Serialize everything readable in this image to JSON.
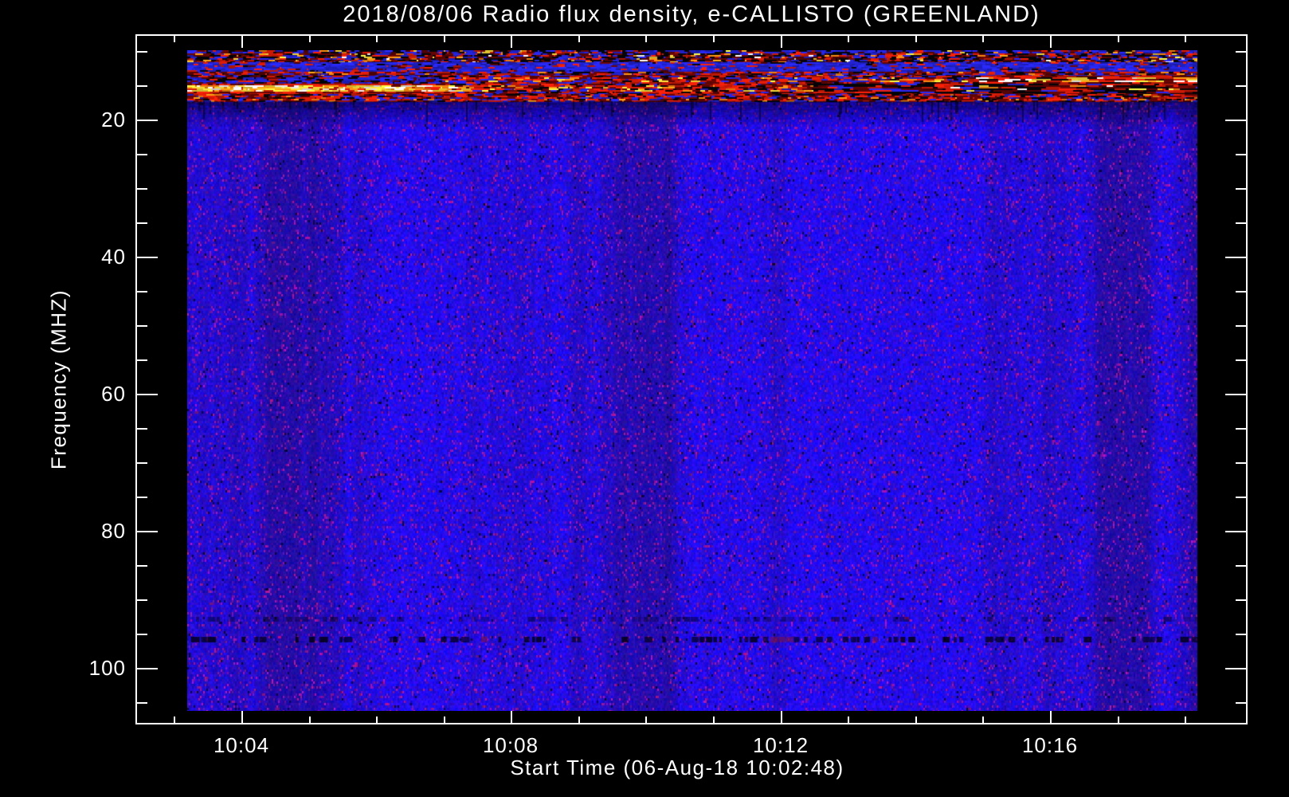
{
  "page": {
    "background": "#000000",
    "text_color": "#ffffff"
  },
  "chart_data": {
    "type": "heatmap",
    "title": "2018/08/06  Radio flux density, e-CALLISTO (GREENLAND)",
    "xlabel": "Start Time (06-Aug-18 10:02:48)",
    "ylabel": "Frequency (MHZ)",
    "x_ticks": [
      {
        "label": "10:04",
        "minute": 4
      },
      {
        "label": "10:08",
        "minute": 8
      },
      {
        "label": "10:12",
        "minute": 12
      },
      {
        "label": "10:16",
        "minute": 16
      }
    ],
    "x_minor_minutes": [
      3,
      5,
      6,
      7,
      9,
      10,
      11,
      13,
      14,
      15,
      17,
      18
    ],
    "y_ticks": [
      {
        "label": "20",
        "mhz": 20
      },
      {
        "label": "40",
        "mhz": 40
      },
      {
        "label": "60",
        "mhz": 60
      },
      {
        "label": "80",
        "mhz": 80
      },
      {
        "label": "100",
        "mhz": 100
      }
    ],
    "y_minor_mhz": [
      10,
      15,
      25,
      30,
      35,
      45,
      50,
      55,
      65,
      70,
      75,
      85,
      90,
      95,
      105
    ],
    "y_axis_inverted": true,
    "grid": false,
    "legend": false,
    "freq_range_mhz": [
      9.9,
      106.3
    ],
    "time_range": [
      "10:03:12",
      "10:18:11"
    ],
    "palette": {
      "blue": "#2323d8",
      "purple_speck": "#7a1aa0",
      "black": "#050508",
      "dark_red": "#5e0505",
      "red": "#d81c08",
      "orange": "#ff8c12",
      "yellow": "#ffe23a",
      "white": "#ffffff"
    },
    "background_noise": {
      "description": "blue vertical-striped noise with sparse purple-red specks",
      "speck_probability": 0.09,
      "dark_dot_probability": 0.015
    },
    "bands": [
      {
        "name": "edge-speckle",
        "freq_mhz": [
          9.9,
          10.35
        ],
        "kind": "speckle",
        "weights": {
          "blue": 0.4,
          "black": 0.22,
          "dark_red": 0.16,
          "red": 0.16,
          "orange": 0.04,
          "yellow": 0.02
        }
      },
      {
        "name": "rfi-heavy",
        "freq_mhz": [
          10.35,
          11.65
        ],
        "kind": "speckle",
        "weights": {
          "black": 0.3,
          "dark_red": 0.22,
          "red": 0.17,
          "blue": 0.2,
          "orange": 0.06,
          "yellow": 0.035,
          "white": 0.015
        }
      },
      {
        "name": "blue-red-speckle",
        "freq_mhz": [
          11.65,
          13.0
        ],
        "kind": "speckle",
        "weights": {
          "blue": 0.8,
          "red": 0.1,
          "dark_red": 0.06,
          "black": 0.04
        }
      },
      {
        "name": "red-mottle",
        "freq_mhz": [
          13.0,
          13.6
        ],
        "kind": "speckle",
        "weights": {
          "dark_red": 0.3,
          "red": 0.25,
          "blue": 0.28,
          "black": 0.13,
          "orange": 0.04
        }
      },
      {
        "name": "rfi-line-14",
        "freq_mhz": [
          13.6,
          14.8
        ],
        "kind": "segmented-line",
        "zones": [
          {
            "until_frac": 0.25,
            "weights": {
              "blue": 0.45,
              "black": 0.25,
              "dark_red": 0.18,
              "red": 0.12
            }
          },
          {
            "until_frac": 0.78,
            "weights": {
              "red": 0.3,
              "dark_red": 0.25,
              "blue": 0.25,
              "black": 0.1,
              "orange": 0.06,
              "yellow": 0.04
            }
          },
          {
            "until_frac": 1.0,
            "weights": {
              "white": 0.22,
              "yellow": 0.2,
              "red": 0.22,
              "dark_red": 0.16,
              "black": 0.12,
              "orange": 0.08
            }
          }
        ]
      },
      {
        "name": "rfi-line-15.5",
        "freq_mhz": [
          14.8,
          16.25
        ],
        "kind": "segmented-line",
        "zones": [
          {
            "until_frac": 0.26,
            "weights": {
              "yellow": 0.42,
              "white": 0.2,
              "orange": 0.22,
              "red": 0.14,
              "dark_red": 0.02
            }
          },
          {
            "until_frac": 0.62,
            "weights": {
              "red": 0.3,
              "orange": 0.14,
              "dark_red": 0.2,
              "black": 0.16,
              "blue": 0.12,
              "yellow": 0.08
            }
          },
          {
            "until_frac": 1.0,
            "weights": {
              "black": 0.38,
              "dark_red": 0.22,
              "red": 0.18,
              "blue": 0.12,
              "orange": 0.05,
              "white": 0.03,
              "yellow": 0.02
            }
          }
        ]
      },
      {
        "name": "red-band",
        "freq_mhz": [
          16.25,
          17.3
        ],
        "kind": "speckle",
        "weights": {
          "red": 0.36,
          "dark_red": 0.26,
          "blue": 0.18,
          "black": 0.14,
          "orange": 0.06
        }
      },
      {
        "name": "dark-fade",
        "freq_mhz": [
          17.3,
          21.0
        ],
        "kind": "fade",
        "alpha": 0.62,
        "streak_probability": 0.1
      },
      {
        "name": "faint-dark-line",
        "freq_mhz": [
          92.6,
          93.2
        ],
        "kind": "dark-dashes",
        "alpha": 0.25
      },
      {
        "name": "dark-line",
        "freq_mhz": [
          95.5,
          96.3
        ],
        "kind": "dark-dashes",
        "alpha": 0.58
      }
    ]
  }
}
